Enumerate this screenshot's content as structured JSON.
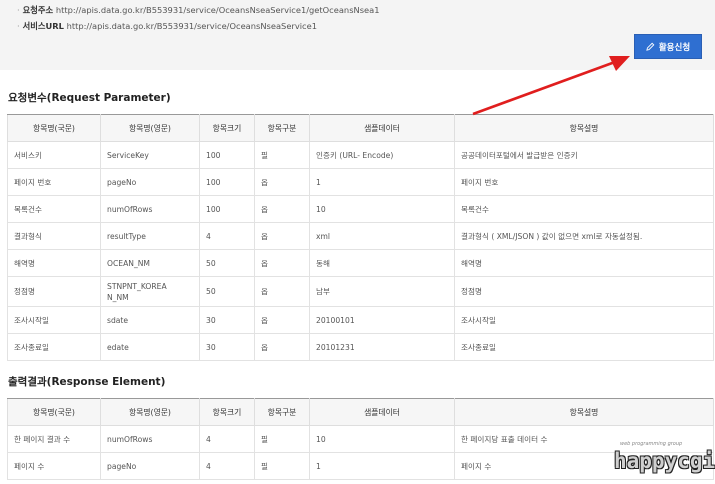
{
  "top": {
    "request_url_label": "요청주소",
    "request_url": "http://apis.data.go.kr/B553931/service/OceansNseaService1/getOceansNsea1",
    "service_url_label": "서비스URL",
    "service_url": "http://apis.data.go.kr/B553931/service/OceansNseaService1",
    "apply_button": "활용신청"
  },
  "request": {
    "title": "요청변수(Request Parameter)",
    "headers": [
      "항목명(국문)",
      "항목명(영문)",
      "항목크기",
      "항목구분",
      "샘플데이터",
      "항목설명"
    ],
    "rows": [
      [
        "서비스키",
        "ServiceKey",
        "100",
        "필",
        "인증키 (URL- Encode)",
        "공공데이터포털에서 발급받은 인증키"
      ],
      [
        "페이지 번호",
        "pageNo",
        "100",
        "옵",
        "1",
        "페이지 번호"
      ],
      [
        "목록건수",
        "numOfRows",
        "100",
        "옵",
        "10",
        "목록건수"
      ],
      [
        "결과형식",
        "resultType",
        "4",
        "옵",
        "xml",
        "결과형식 ( XML/JSON ) 값이 없으면 xml로 자동설정됨."
      ],
      [
        "해역명",
        "OCEAN_NM",
        "50",
        "옵",
        "동해",
        "해역명"
      ],
      [
        "정점명",
        "STNPNT_KOREAN_NM",
        "50",
        "옵",
        "남부",
        "정점명"
      ],
      [
        "조사시작일",
        "sdate",
        "30",
        "옵",
        "20100101",
        "조사시작일"
      ],
      [
        "조사종료일",
        "edate",
        "30",
        "옵",
        "20101231",
        "조사종료일"
      ]
    ]
  },
  "response": {
    "title": "출력결과(Response Element)",
    "headers": [
      "항목명(국문)",
      "항목명(영문)",
      "항목크기",
      "항목구분",
      "샘플데이터",
      "항목설명"
    ],
    "rows": [
      [
        "한 페이지 결과 수",
        "numOfRows",
        "4",
        "필",
        "10",
        "한 페이지당 표출 데이터 수"
      ],
      [
        "페이지 수",
        "pageNo",
        "4",
        "필",
        "1",
        "페이지 수"
      ]
    ]
  },
  "watermark": {
    "sub": "web programming group",
    "text": "happycgi"
  },
  "colors": {
    "button": "#2f6fd1",
    "arrow": "#e01e1e",
    "header_bg": "#f6f6f6"
  }
}
